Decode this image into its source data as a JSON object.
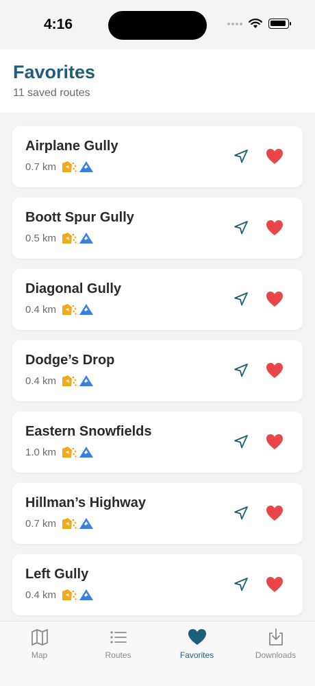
{
  "status_bar": {
    "time": "4:16"
  },
  "header": {
    "title": "Favorites",
    "subtitle": "11 saved routes"
  },
  "colors": {
    "accent": "#1f5e78",
    "heart": "#e8474a",
    "badge_orange": "#f0a81c",
    "badge_blue": "#3b7fe0"
  },
  "routes": [
    {
      "name": "Airplane Gully",
      "distance": "0.7 km"
    },
    {
      "name": "Boott Spur Gully",
      "distance": "0.5 km"
    },
    {
      "name": "Diagonal Gully",
      "distance": "0.4 km"
    },
    {
      "name": "Dodge’s Drop",
      "distance": "0.4 km"
    },
    {
      "name": "Eastern Snowfields",
      "distance": "1.0 km"
    },
    {
      "name": "Hillman’s Highway",
      "distance": "0.7 km"
    },
    {
      "name": "Left Gully",
      "distance": "0.4 km"
    }
  ],
  "tabs": [
    {
      "label": "Map",
      "icon": "map-icon"
    },
    {
      "label": "Routes",
      "icon": "list-icon"
    },
    {
      "label": "Favorites",
      "icon": "heart-icon",
      "active": true
    },
    {
      "label": "Downloads",
      "icon": "download-icon"
    }
  ]
}
